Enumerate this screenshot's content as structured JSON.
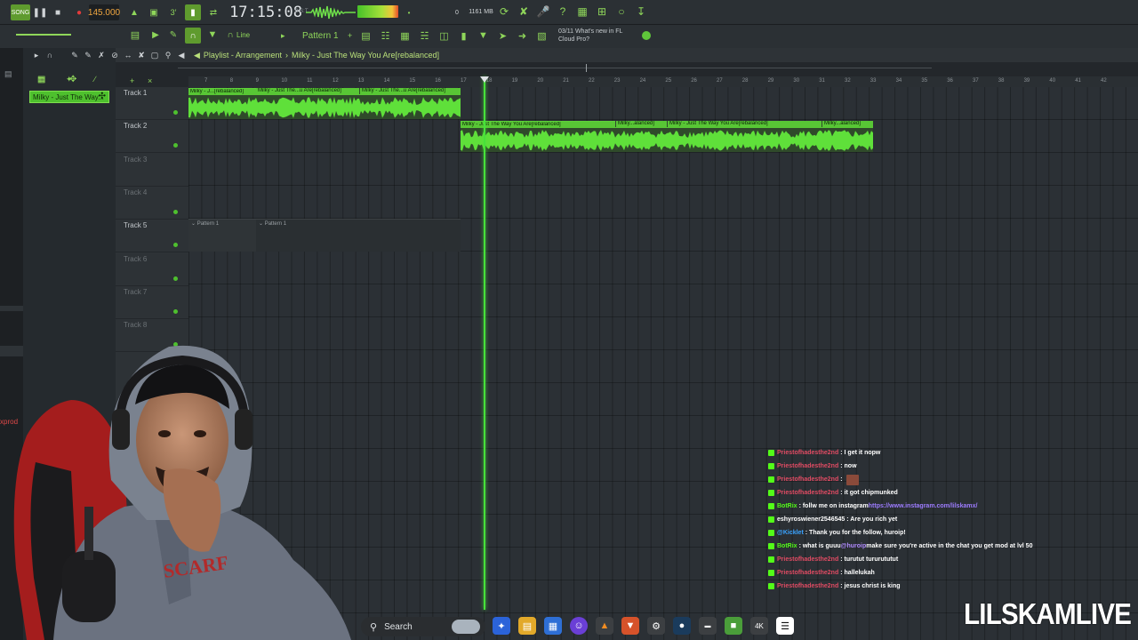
{
  "toolbar": {
    "song_label": "SONG",
    "tempo": "145.000",
    "time": "17:15:08",
    "time_suffix": "B:S:T",
    "memory": "1161 MB",
    "memory_sub": "0",
    "pattern": "Pattern 1",
    "snap": "Line",
    "news_date": "03/11",
    "news_text": "What's new in FL",
    "news_text2": "Cloud Pro?"
  },
  "playlist": {
    "title": "Playlist - Arrangement",
    "separator": "›",
    "song": "Milky - Just The Way You Are[rebalanced]"
  },
  "channel_clip": "Milky - Just The Way...",
  "ruler_marks": [
    "7",
    "8",
    "9",
    "10",
    "11",
    "12",
    "13",
    "14",
    "15",
    "16",
    "17",
    "18",
    "19",
    "20",
    "21",
    "22",
    "23",
    "24",
    "25",
    "26",
    "27",
    "28",
    "29",
    "30",
    "31",
    "32",
    "33",
    "34",
    "35",
    "36",
    "37",
    "38",
    "39",
    "40",
    "41",
    "42"
  ],
  "tracks": [
    {
      "name": "Track 1",
      "dim": false
    },
    {
      "name": "Track 2",
      "dim": false
    },
    {
      "name": "Track 3",
      "dim": true
    },
    {
      "name": "Track 4",
      "dim": true
    },
    {
      "name": "Track 5",
      "dim": false
    },
    {
      "name": "Track 6",
      "dim": true
    },
    {
      "name": "Track 7",
      "dim": true
    },
    {
      "name": "Track 8",
      "dim": true
    }
  ],
  "clips": {
    "track1_a": "Milky - J...[rebalanced]",
    "track1_b": "Milky - Just The...u Are[rebalanced]",
    "track1_c": "Milky - Just The...u Are[rebalanced]",
    "track2_a": "Milky - Just The Way You Are[rebalanced]",
    "track2_b": "Milky...alanced]",
    "track2_c": "Milky - Just The Way You Are[rebalanced]",
    "track2_d": "Milky...alanced]",
    "pattern_a": "Pattern 1",
    "pattern_b": "Pattern 1"
  },
  "side_label": "xprod",
  "chat": [
    {
      "user": "Priestofhadesthe2nd",
      "msg": ": I get it nopw",
      "userColor": "red"
    },
    {
      "user": "Priestofhadesthe2nd",
      "msg": ": now",
      "userColor": "red"
    },
    {
      "user": "Priestofhadesthe2nd",
      "msg": ":",
      "userColor": "red"
    },
    {
      "user": "Priestofhadesthe2nd",
      "msg": ": it got chipmunked",
      "userColor": "red"
    },
    {
      "user": "BotRix",
      "msg": ": follw me on instagram ",
      "link": "https://www.instagram.com/lilskamx/",
      "userColor": "green"
    },
    {
      "user": "eshyroswiener2546545",
      "msg": ": Are you rich yet",
      "userColor": "white"
    },
    {
      "user": "@Kicklet",
      "msg": ": Thank you for the follow, huroip!",
      "userColor": "blue"
    },
    {
      "user": "BotRix",
      "msg": ": what is guuu ",
      "mention": "@huroip",
      "msg2": " make sure you're active in the chat you get mod at lvl 50",
      "userColor": "green"
    },
    {
      "user": "Priestofhadesthe2nd",
      "msg": ": turutut tururututut",
      "userColor": "red"
    },
    {
      "user": "Priestofhadesthe2nd",
      "msg": ": hallelukah",
      "userColor": "red"
    },
    {
      "user": "Priestofhadesthe2nd",
      "msg": ": jesus christ is king",
      "userColor": "red"
    }
  ],
  "taskbar": {
    "search_label": "Search"
  },
  "watermark": "LILSKAMLIVE"
}
